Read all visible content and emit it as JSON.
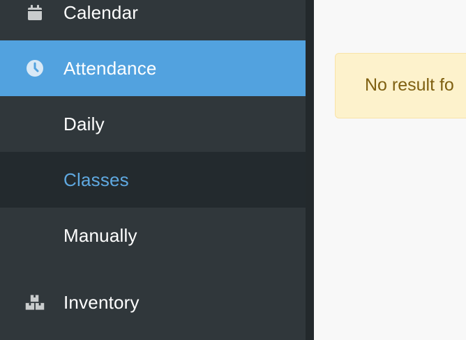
{
  "sidebar": {
    "items": [
      {
        "label": "Calendar",
        "icon": "calendar-icon"
      },
      {
        "label": "Attendance",
        "icon": "clock-icon",
        "active": true
      },
      {
        "label": "Daily"
      },
      {
        "label": "Classes",
        "selected": true
      },
      {
        "label": "Manually"
      },
      {
        "label": "Inventory",
        "icon": "boxes-icon"
      }
    ]
  },
  "main": {
    "alert_text": "No result fo"
  },
  "colors": {
    "sidebar_bg": "#30373b",
    "active_bg": "#52a2df",
    "selected_bg": "#232a2e",
    "selected_text": "#5fa8e0",
    "alert_bg": "#fdf2cc",
    "alert_text": "#7f6011"
  }
}
